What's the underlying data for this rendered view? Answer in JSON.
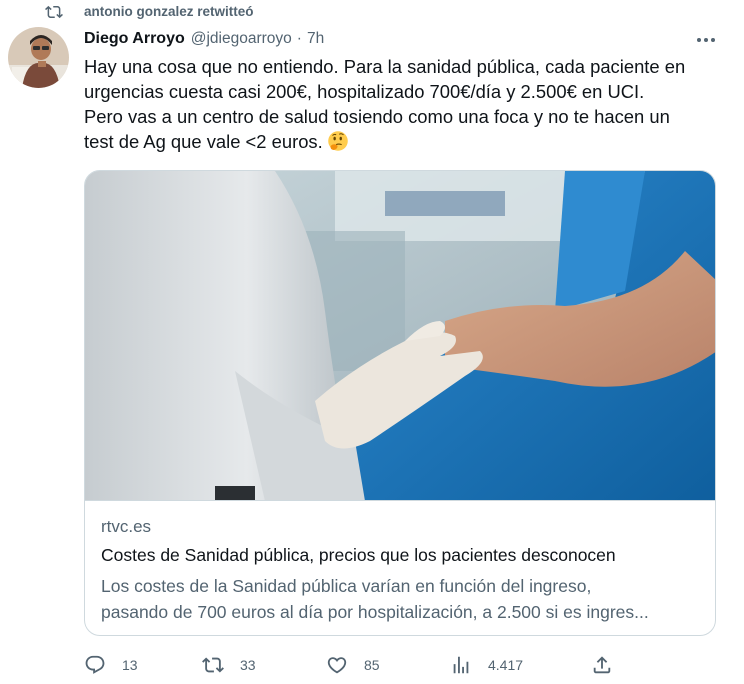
{
  "retweet": {
    "text": "antonio gonzalez retwitteó",
    "icon": "retweet-icon"
  },
  "author": {
    "name": "Diego Arroyo",
    "handle": "@jdiegoarroyo",
    "separator": "·",
    "time": "7h"
  },
  "tweet": {
    "lines": [
      "Hay una cosa que no entiendo. Para la sanidad pública, cada paciente en",
      "urgencias cuesta casi 200€,  hospitalizado 700€/día y 2.500€ en UCI.",
      "Pero vas a un centro de salud tosiendo como una foca y no te hacen un",
      "test de Ag que vale <2 euros."
    ],
    "emoji": "thinking-face-emoji"
  },
  "card": {
    "domain": "rtvc.es",
    "title": "Costes de Sanidad pública, precios que los pacientes desconocen",
    "description_lines": [
      "Los costes de la Sanidad pública varían en función del ingreso,",
      "pasando de 700 euros al día por hospitalización, a 2.500 si es ingres..."
    ]
  },
  "actions": {
    "replies": "13",
    "retweets": "33",
    "likes": "85",
    "views": "4.417"
  },
  "colors": {
    "text": "#0f1419",
    "secondary": "#536471",
    "border": "#cfd9de",
    "scrub_blue": "#1a73b8"
  }
}
